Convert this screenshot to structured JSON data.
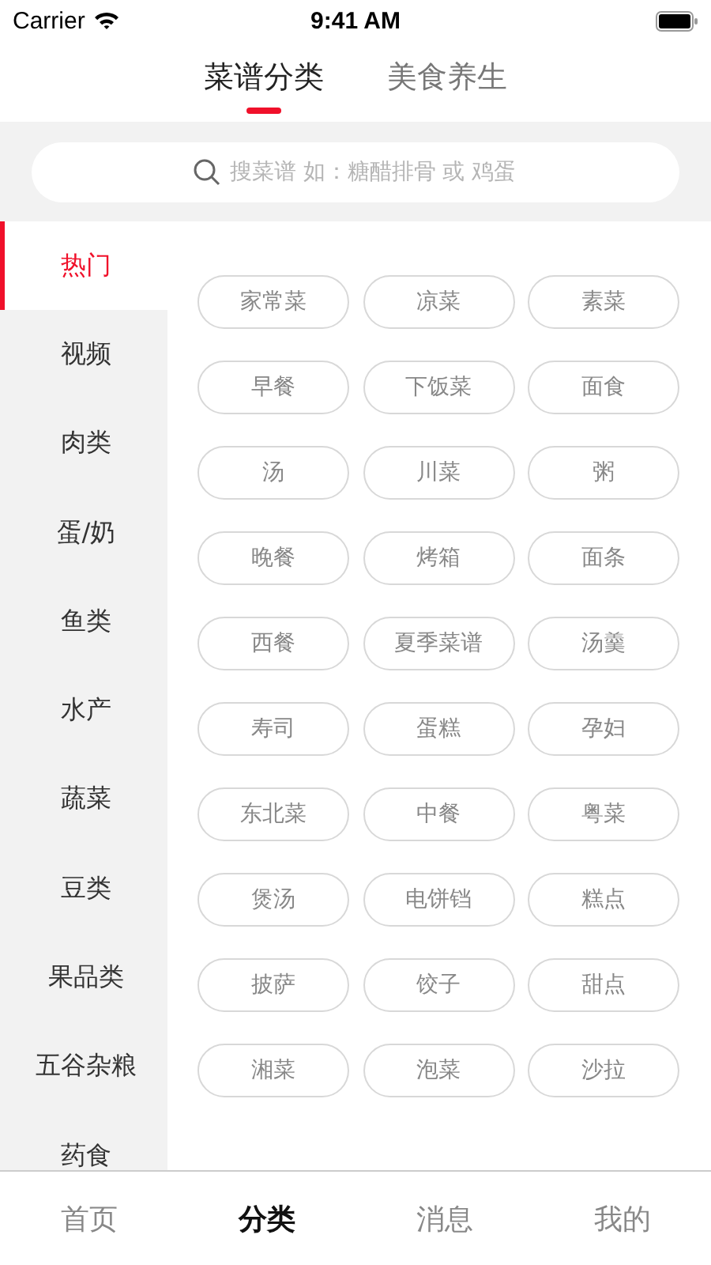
{
  "status_bar": {
    "carrier": "Carrier",
    "time": "9:41 AM"
  },
  "tabs": [
    {
      "label": "菜谱分类",
      "selected": true
    },
    {
      "label": "美食养生",
      "selected": false
    }
  ],
  "search": {
    "placeholder": "搜菜谱 如：糖醋排骨 或 鸡蛋"
  },
  "sidebar": {
    "items": [
      {
        "label": "热门",
        "selected": true
      },
      {
        "label": "视频",
        "selected": false
      },
      {
        "label": "肉类",
        "selected": false
      },
      {
        "label": "蛋/奶",
        "selected": false
      },
      {
        "label": "鱼类",
        "selected": false
      },
      {
        "label": "水产",
        "selected": false
      },
      {
        "label": "蔬菜",
        "selected": false
      },
      {
        "label": "豆类",
        "selected": false
      },
      {
        "label": "果品类",
        "selected": false
      },
      {
        "label": "五谷杂粮",
        "selected": false
      },
      {
        "label": "药食",
        "selected": false
      }
    ]
  },
  "tags": [
    "家常菜",
    "凉菜",
    "素菜",
    "早餐",
    "下饭菜",
    "面食",
    "汤",
    "川菜",
    "粥",
    "晚餐",
    "烤箱",
    "面条",
    "西餐",
    "夏季菜谱",
    "汤羹",
    "寿司",
    "蛋糕",
    "孕妇",
    "东北菜",
    "中餐",
    "粤菜",
    "煲汤",
    "电饼铛",
    "糕点",
    "披萨",
    "饺子",
    "甜点",
    "湘菜",
    "泡菜",
    "沙拉"
  ],
  "tab_bar": [
    {
      "label": "首页",
      "selected": false
    },
    {
      "label": "分类",
      "selected": true
    },
    {
      "label": "消息",
      "selected": false
    },
    {
      "label": "我的",
      "selected": false
    }
  ]
}
